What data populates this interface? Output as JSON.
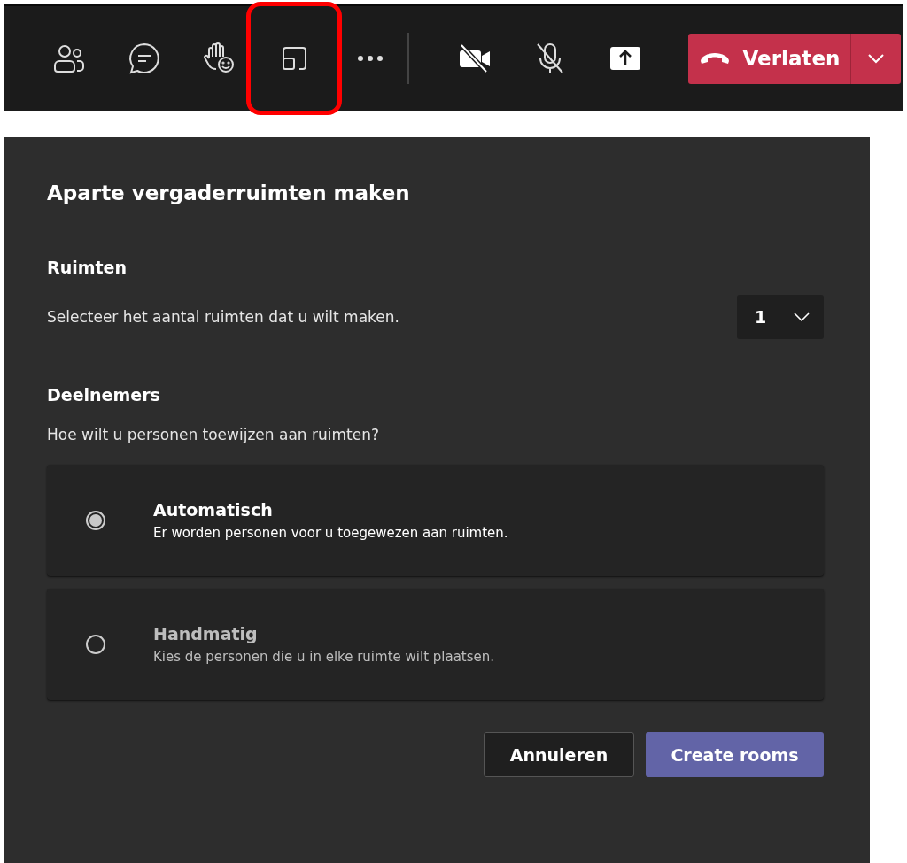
{
  "toolbar": {
    "items": [
      {
        "kind": "people",
        "highlighted": false
      },
      {
        "kind": "chat",
        "highlighted": false
      },
      {
        "kind": "reactions",
        "highlighted": false
      },
      {
        "kind": "rooms",
        "highlighted": true
      },
      {
        "kind": "more",
        "highlighted": false
      },
      {
        "kind": "divider"
      },
      {
        "kind": "camera",
        "on": false,
        "highlighted": false
      },
      {
        "kind": "mic",
        "on": false,
        "highlighted": false
      },
      {
        "kind": "share",
        "highlighted": false
      }
    ],
    "leave_button": {
      "label": "Verlaten"
    }
  },
  "dialog": {
    "title": "Aparte vergaderruimten maken",
    "rooms": {
      "heading": "Ruimten",
      "description": "Selecteer het aantal ruimten dat u wilt maken.",
      "value": "1"
    },
    "participants": {
      "heading": "Deelnemers",
      "question": "Hoe wilt u personen toewijzen aan ruimten?",
      "options": [
        {
          "title": "Automatisch",
          "description": "Er worden personen voor u toegewezen aan ruimten.",
          "selected": true
        },
        {
          "title": "Handmatig",
          "description": "Kies de personen die u in elke ruimte wilt plaatsen.",
          "selected": false
        }
      ]
    },
    "buttons": [
      {
        "label": "Annuleren",
        "kind": "secondary"
      },
      {
        "label": "Create rooms",
        "kind": "primary"
      }
    ]
  }
}
